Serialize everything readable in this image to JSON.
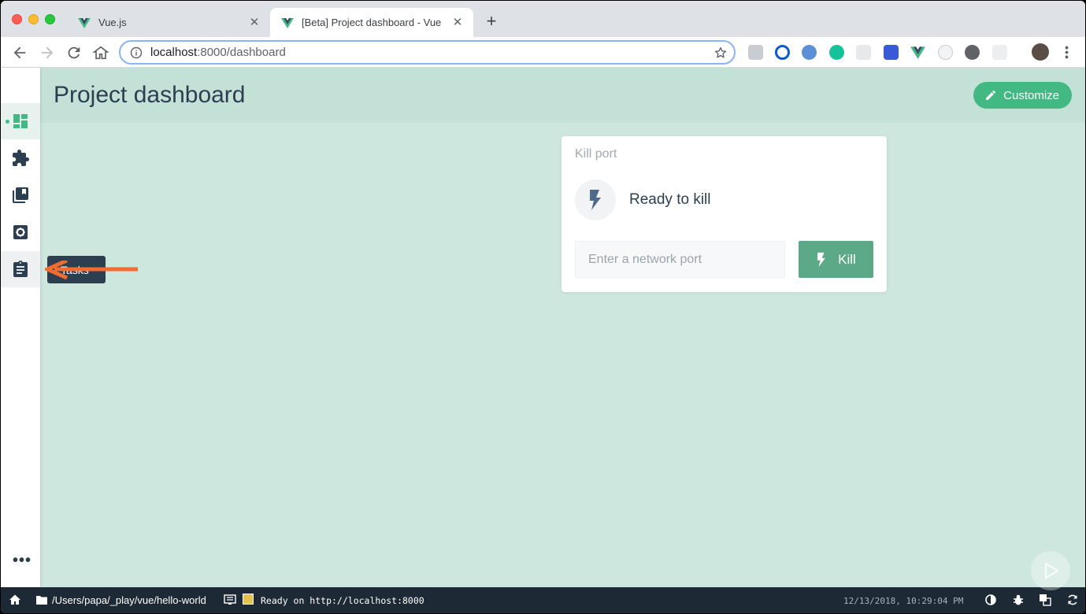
{
  "browser": {
    "tabs": [
      {
        "title": "Vue.js",
        "active": false
      },
      {
        "title": "[Beta] Project dashboard - Vue",
        "active": true
      }
    ],
    "new_tab_glyph": "+",
    "close_glyph": "✕",
    "address": {
      "host": "localhost",
      "rest": ":8000/dashboard"
    },
    "extensions": [
      "copy-icon",
      "1password-icon",
      "blur-icon",
      "grammarly-icon",
      "tree-icon",
      "bookmark-icon",
      "vue-devtools-icon",
      "clock-icon",
      "puzzle-icon",
      "grid-icon",
      "profile-avatar",
      "menu-dots-icon"
    ]
  },
  "sidebar": {
    "items": [
      {
        "name": "dashboard",
        "icon": "dashboard-icon",
        "active": true
      },
      {
        "name": "plugins",
        "icon": "puzzle-icon",
        "active": false
      },
      {
        "name": "dependencies",
        "icon": "library-icon",
        "active": false
      },
      {
        "name": "configuration",
        "icon": "settings-icon",
        "active": false
      },
      {
        "name": "tasks",
        "icon": "clipboard-icon",
        "active": false
      }
    ],
    "more_label": "•••",
    "tooltip": "Tasks"
  },
  "header": {
    "title": "Project dashboard",
    "customize_label": "Customize"
  },
  "widget": {
    "title": "Kill port",
    "status": "Ready to kill",
    "input_placeholder": "Enter a network port",
    "input_value": "",
    "button_label": "Kill"
  },
  "statusbar": {
    "path": "/Users/papa/_play/vue/hello-world",
    "log": "Ready on http://localhost:8000",
    "datetime": "12/13/2018, 10:29:04 PM"
  },
  "colors": {
    "accent": "#42b983",
    "dark": "#2c3e50",
    "app_bg": "#cde6de",
    "header_bg": "#c3e1d7",
    "statusbar_bg": "#1d2935",
    "annotation_arrow": "#f26b2f"
  }
}
